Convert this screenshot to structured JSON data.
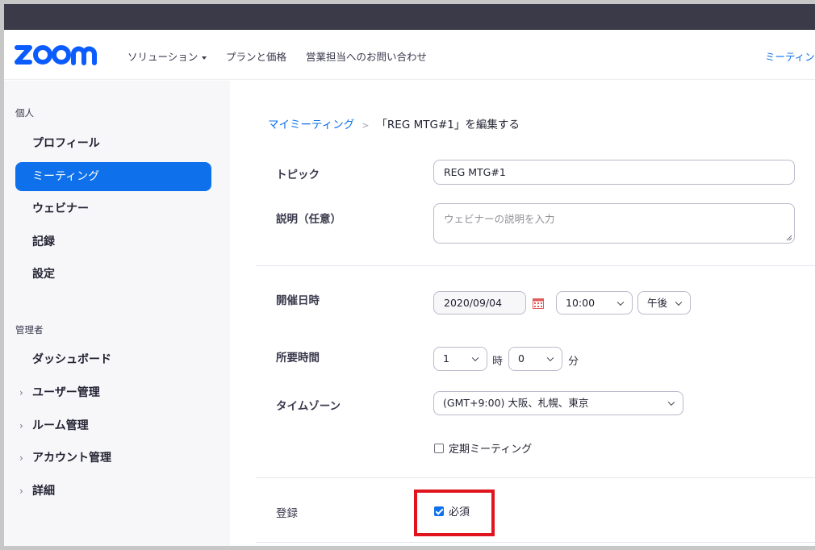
{
  "header": {
    "nav": [
      {
        "label": "ソリューション",
        "has_caret": true
      },
      {
        "label": "プランと価格"
      },
      {
        "label": "営業担当へのお問い合わせ"
      }
    ],
    "right_link": "ミーティン"
  },
  "sidebar": {
    "personal_section": "個人",
    "personal_items": [
      {
        "label": "プロフィール"
      },
      {
        "label": "ミーティング",
        "active": true
      },
      {
        "label": "ウェビナー"
      },
      {
        "label": "記録"
      },
      {
        "label": "設定"
      }
    ],
    "admin_section": "管理者",
    "admin_items": [
      {
        "label": "ダッシュボード"
      },
      {
        "label": "ユーザー管理",
        "expandable": true
      },
      {
        "label": "ルーム管理",
        "expandable": true
      },
      {
        "label": "アカウント管理",
        "expandable": true
      },
      {
        "label": "詳細",
        "expandable": true
      }
    ]
  },
  "breadcrumb": {
    "link": "マイミーティング",
    "separator": ">",
    "current": "「REG MTG#1」を編集する"
  },
  "form": {
    "topic_label": "トピック",
    "topic_value": "REG MTG#1",
    "description_label": "説明（任意）",
    "description_placeholder": "ウェビナーの説明を入力",
    "datetime_label": "開催日時",
    "date_value": "2020/09/04",
    "time_value": "10:00",
    "ampm_value": "午後",
    "duration_label": "所要時間",
    "hours_value": "1",
    "hours_unit": "時",
    "minutes_value": "0",
    "minutes_unit": "分",
    "timezone_label": "タイムゾーン",
    "timezone_value": "(GMT+9:00) 大阪、札幌、東京",
    "recurring_label": "定期ミーティング",
    "recurring_checked": false,
    "registration_label": "登録",
    "required_label": "必須",
    "required_checked": true
  },
  "colors": {
    "accent": "#0e71eb",
    "highlight_box": "#e0141e",
    "topbar": "#3a3a48"
  },
  "icons": {
    "calendar": "calendar-icon",
    "dropdown": "chevron-down-icon",
    "expand": "chevron-right-icon"
  }
}
